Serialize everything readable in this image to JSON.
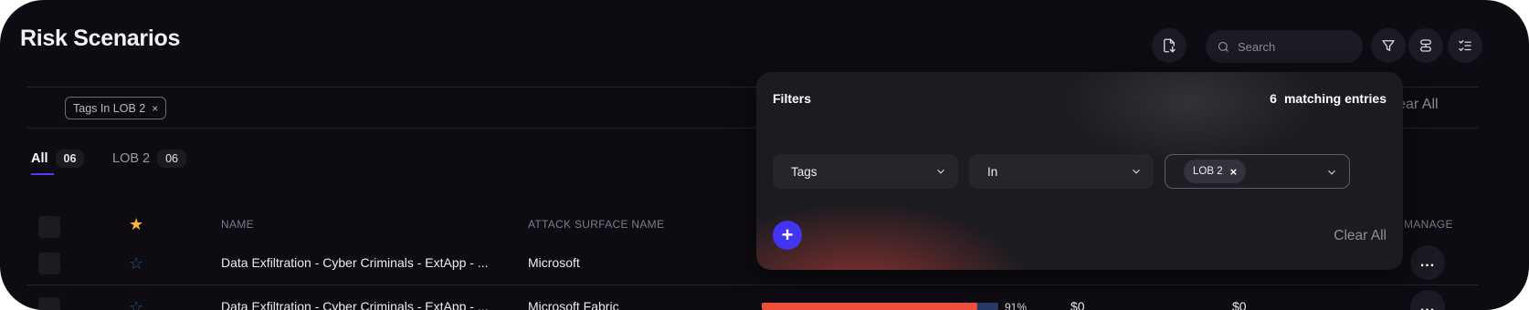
{
  "page": {
    "title": "Risk Scenarios"
  },
  "toolbar": {
    "export_icon": "file-download-icon",
    "search_placeholder": "Search",
    "filter_icon": "filter-icon",
    "group_icon": "stack-icon",
    "columns_icon": "checklist-icon"
  },
  "active_filter": {
    "chip_label": "Tags In LOB 2",
    "remove": "×",
    "clear_all": "Clear All"
  },
  "tabs": [
    {
      "label": "All",
      "count": "06"
    },
    {
      "label": "LOB 2",
      "count": "06"
    }
  ],
  "table": {
    "columns": [
      "NAME",
      "ATTACK SURFACE NAME",
      "MANAGE"
    ],
    "rows": [
      {
        "name": "Data Exfiltration - Cyber Criminals - ExtApp - ...",
        "attack_surface": "Microsoft",
        "manage": "..."
      },
      {
        "name": "Data Exfiltration - Cyber Criminals - ExtApp - ...",
        "attack_surface": "Microsoft Fabric",
        "progress": 0.91,
        "progress_label": "91%",
        "value_a": "$0",
        "value_b": "$0"
      }
    ]
  },
  "filters_panel": {
    "title": "Filters",
    "match_count": "6",
    "match_label": "matching entries",
    "field": "Tags",
    "operator": "In",
    "values": [
      "LOB 2"
    ],
    "value_remove": "×",
    "add_label": "+",
    "clear_all": "Clear All"
  },
  "colors": {
    "accent": "#4333f2",
    "star_selected": "#f5b83d",
    "star_outline": "#2e5a8a",
    "progress": "#f0503c"
  }
}
